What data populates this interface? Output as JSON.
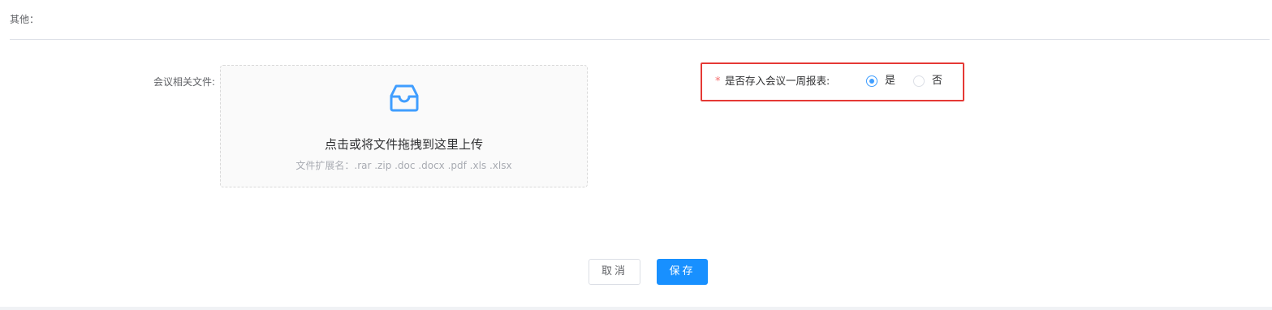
{
  "section": {
    "title": "其他："
  },
  "upload": {
    "label": "会议相关文件:",
    "main_text": "点击或将文件拖拽到这里上传",
    "hint": "文件扩展名：.rar .zip .doc .docx .pdf .xls .xlsx",
    "icon": "inbox-icon",
    "icon_color": "#409eff"
  },
  "report_field": {
    "required_mark": "*",
    "label": "是否存入会议一周报表:",
    "options": [
      {
        "label": "是",
        "checked": true
      },
      {
        "label": "否",
        "checked": false
      }
    ],
    "highlight_color": "#e53935"
  },
  "actions": {
    "cancel_label": "取消",
    "save_label": "保存",
    "primary_color": "#1890ff"
  }
}
